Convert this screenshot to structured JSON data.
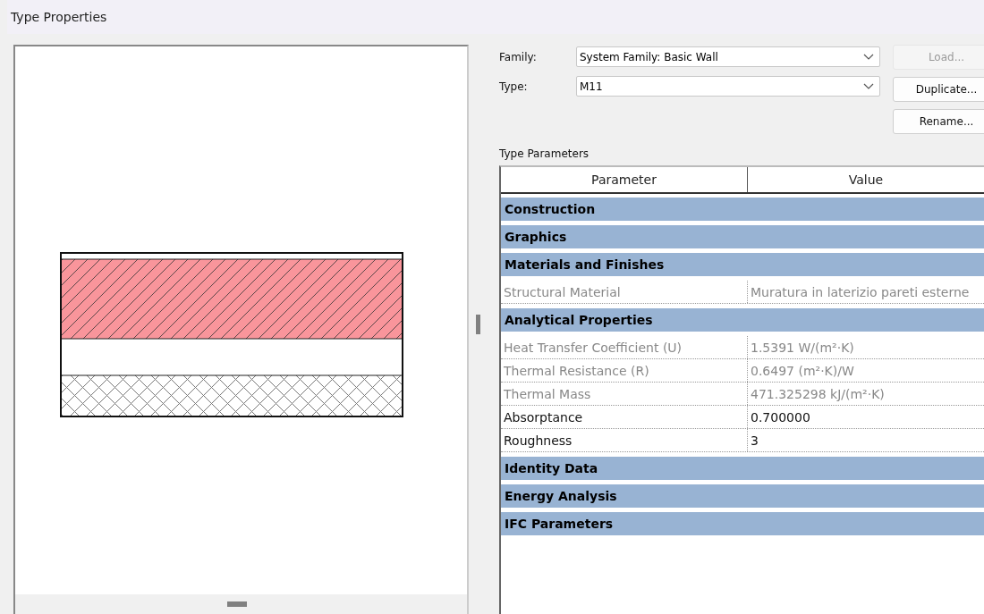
{
  "window": {
    "title": "Type Properties"
  },
  "family": {
    "label": "Family:",
    "value": "System Family: Basic Wall"
  },
  "type": {
    "label": "Type:",
    "value": "M11"
  },
  "buttons": [
    {
      "label": "Load...",
      "disabled": true
    },
    {
      "label": "Duplicate...",
      "disabled": false
    },
    {
      "label": "Rename...",
      "disabled": false
    }
  ],
  "type_parameters": {
    "title": "Type Parameters",
    "columns": [
      "Parameter",
      "Value"
    ],
    "rows": [
      {
        "kind": "group",
        "label": "Construction"
      },
      {
        "kind": "group",
        "label": "Graphics"
      },
      {
        "kind": "group",
        "label": "Materials and Finishes"
      },
      {
        "kind": "param",
        "label": "Structural Material",
        "value": "Muratura in laterizio pareti esterne",
        "disabled": true
      },
      {
        "kind": "group",
        "label": "Analytical Properties"
      },
      {
        "kind": "param",
        "label": "Heat Transfer Coefficient (U)",
        "value": "1.5391 W/(m²·K)",
        "disabled": true
      },
      {
        "kind": "param",
        "label": "Thermal Resistance (R)",
        "value": "0.6497 (m²·K)/W",
        "disabled": true
      },
      {
        "kind": "param",
        "label": "Thermal Mass",
        "value": "471.325298 kJ/(m²·K)",
        "disabled": true
      },
      {
        "kind": "param",
        "label": "Absorptance",
        "value": "0.700000",
        "disabled": false
      },
      {
        "kind": "param",
        "label": "Roughness",
        "value": "3",
        "disabled": false
      },
      {
        "kind": "group",
        "label": "Identity Data"
      },
      {
        "kind": "group",
        "label": "Energy Analysis"
      },
      {
        "kind": "group",
        "label": "IFC Parameters"
      }
    ]
  }
}
